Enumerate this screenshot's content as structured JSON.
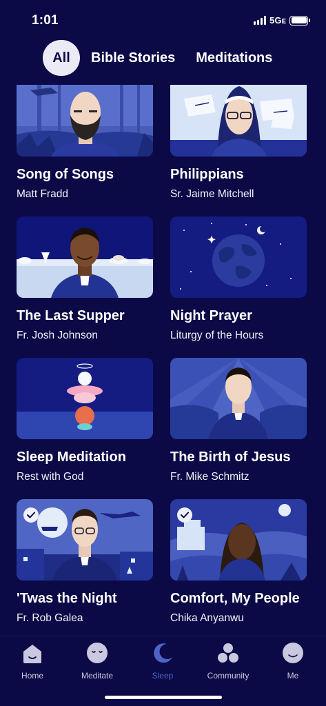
{
  "status": {
    "time": "1:01",
    "network": "5Gᴇ"
  },
  "tabs": {
    "all": "All",
    "bible_stories": "Bible Stories",
    "meditations": "Meditations"
  },
  "cards": [
    {
      "title": "Song of Songs",
      "subtitle": "Matt Fradd",
      "completed": false
    },
    {
      "title": "Philippians",
      "subtitle": "Sr. Jaime Mitchell",
      "completed": false
    },
    {
      "title": "The Last Supper",
      "subtitle": "Fr. Josh Johnson",
      "completed": false
    },
    {
      "title": "Night Prayer",
      "subtitle": "Liturgy of the Hours",
      "completed": false
    },
    {
      "title": "Sleep Meditation",
      "subtitle": "Rest with God",
      "completed": false
    },
    {
      "title": "The Birth of Jesus",
      "subtitle": "Fr. Mike Schmitz",
      "completed": false
    },
    {
      "title": "'Twas the Night",
      "subtitle": "Fr. Rob Galea",
      "completed": true
    },
    {
      "title": "Comfort, My People",
      "subtitle": "Chika Anyanwu",
      "completed": true
    }
  ],
  "nav": {
    "home": "Home",
    "meditate": "Meditate",
    "sleep": "Sleep",
    "community": "Community",
    "me": "Me",
    "active": "sleep"
  },
  "colors": {
    "background": "#0b0a47",
    "accent": "#4f63c9",
    "tab_active_bg": "#eceaf4"
  }
}
